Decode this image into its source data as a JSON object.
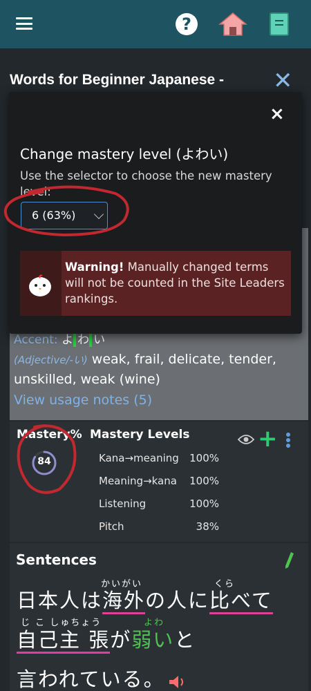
{
  "header": {
    "title": "Words for Beginner Japanese -"
  },
  "word": {
    "accent_label": "Accent:",
    "accent_kana_1": "よ",
    "accent_kana_2": "わ",
    "accent_kana_3": "い",
    "part_of_speech": "(Adjective/-い)",
    "definition": " weak, frail, delicate, tender, unskilled, weak (wine)",
    "usage_link": "View usage notes (5)"
  },
  "mastery": {
    "label": "Mastery%",
    "value": "84",
    "value_fraction": 0.84,
    "levels_title": "Mastery Levels",
    "levels": [
      {
        "name": "Kana→meaning",
        "pct": "100%"
      },
      {
        "name": "Meaning→kana",
        "pct": "100%"
      },
      {
        "name": "Listening",
        "pct": "100%"
      },
      {
        "name": "Pitch",
        "pct": "38%"
      }
    ]
  },
  "sentences": {
    "title": "Sentences",
    "line1": {
      "plain1": "日本人は",
      "ul1": "海外",
      "plain2": "の人に",
      "ul2": "比べて",
      "furi1": "かいがい",
      "furi2": "くら"
    },
    "line2": {
      "ul1": "自己主 張",
      "plain1": "が",
      "green": "弱い",
      "plain2": "と",
      "furi1": "じ こ しゅちょう",
      "furi2": "よわ"
    },
    "line3": "言われている。"
  },
  "modal": {
    "close": "×",
    "title": "Change mastery level (よわい)",
    "desc": "Use the selector to choose the new mastery level:",
    "selected": "6 (63%)",
    "warning_bold": "Warning!",
    "warning_text": " Manually changed terms will not be counted in the Site Leaders rankings."
  },
  "colors": {
    "topbar": "#1e5461",
    "accent_blue": "#8ab8e6",
    "underline_pink": "#e0409a",
    "green": "#4fc34f",
    "warning_bg": "#5a2222",
    "annotation_red": "#c2282f"
  }
}
